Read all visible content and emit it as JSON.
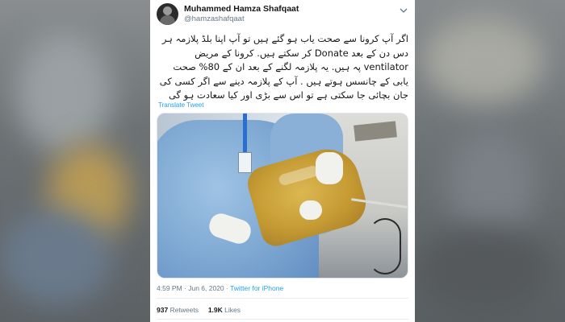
{
  "tweet": {
    "author_name": "Muhammed Hamza Shafqaat",
    "author_handle": "@hamzashafqaat",
    "text": "اگر آپ کرونا سے صحت یاب ہو گئے ہیں تو آپ اپنا بلڈ پلازمہ ہر دس دن کے بعد Donate کر سکتے ہیں. کرونا کے مریض ventilator پہ ہیں. یہ پلازمہ لگنے کے بعد ان کے 80% صحت یابی کے چانسس ہوتے ہیں . آپ کے پلازمہ دینے سے اگر کسی کی جان بچائی جا سکتی ہے تو اس سے بڑی اور کیا سعادت ہو گی",
    "translate_label": "Translate Tweet",
    "time": "4:59 PM",
    "date": "Jun 6, 2020",
    "separator": " · ",
    "source": "Twitter for iPhone",
    "retweets_count": "937",
    "retweets_label": "Retweets",
    "likes_count": "1.9K",
    "likes_label": "Likes"
  },
  "icons": {
    "caret": "chevron-down-icon"
  },
  "colors": {
    "link": "#1da1f2",
    "text": "#14171a",
    "secondary": "#657786"
  }
}
